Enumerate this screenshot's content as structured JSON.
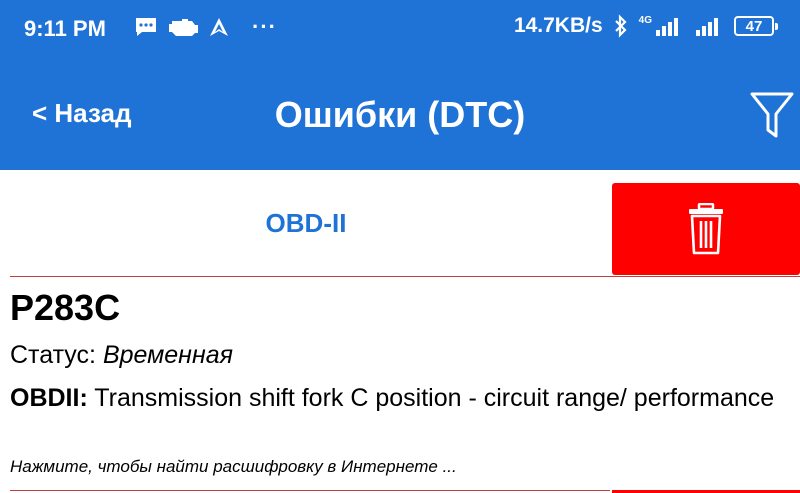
{
  "status_bar": {
    "time": "9:11 PM",
    "dots": "···",
    "net_speed": "14.7KB/s",
    "network_type": "4G",
    "battery": "47"
  },
  "nav": {
    "back_label": "< Назад",
    "title": "Ошибки (DTC)"
  },
  "tabs": {
    "obd_label": "OBD-II"
  },
  "dtc": {
    "code": "P283C",
    "status_label": "Статус:",
    "status_value": "Временная",
    "desc_label": "OBDII:",
    "desc_text": "Transmission shift fork C position - circuit range/ performance",
    "hint": "Нажмите, чтобы найти расшифровку в Интернете ..."
  },
  "colors": {
    "primary": "#1f72d6",
    "delete": "#ff0000",
    "text": "#000000"
  }
}
